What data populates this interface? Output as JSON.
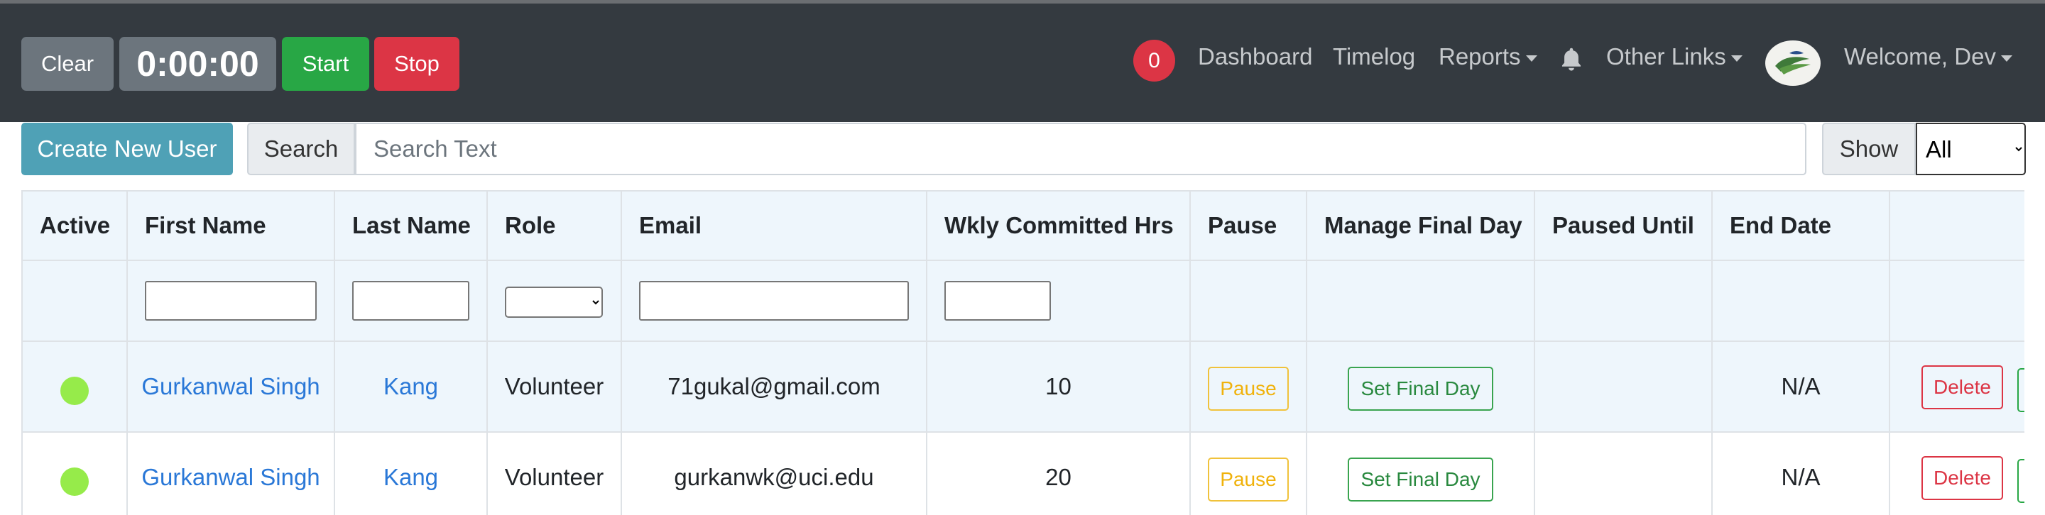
{
  "timer": {
    "clear_label": "Clear",
    "time": "0:00:00",
    "start_label": "Start",
    "stop_label": "Stop"
  },
  "nav": {
    "notification_count": "0",
    "dashboard": "Dashboard",
    "timelog": "Timelog",
    "reports": "Reports",
    "other_links": "Other Links",
    "welcome": "Welcome, Dev"
  },
  "toolbar": {
    "create_user": "Create New User",
    "search_label": "Search",
    "search_placeholder": "Search Text",
    "show_label": "Show",
    "show_selected": "All"
  },
  "table": {
    "headers": [
      "Active",
      "First Name",
      "Last Name",
      "Role",
      "Email",
      "Wkly Committed Hrs",
      "Pause",
      "Manage Final Day",
      "Paused Until",
      "End Date",
      ""
    ],
    "rows": [
      {
        "first": "Gurkanwal Singh",
        "last": "Kang",
        "role": "Volunteer",
        "email": "71gukal@gmail.com",
        "hours": "10",
        "pause": "Pause",
        "final": "Set Final Day",
        "paused_until": "",
        "end_date": "N/A",
        "delete": "Delete"
      },
      {
        "first": "Gurkanwal Singh",
        "last": "Kang",
        "role": "Volunteer",
        "email": "gurkanwk@uci.edu",
        "hours": "20",
        "pause": "Pause",
        "final": "Set Final Day",
        "paused_until": "",
        "end_date": "N/A",
        "delete": "Delete"
      }
    ]
  },
  "colors": {
    "navbar": "#343a40",
    "active_dot": "#96eb4a",
    "link": "#2a78d7",
    "danger": "#dc3545",
    "success": "#28a745",
    "warning": "#f0b20c",
    "info": "#4fa1b6"
  },
  "icons": {
    "bell": "bell-icon",
    "logo": "community-logo"
  }
}
